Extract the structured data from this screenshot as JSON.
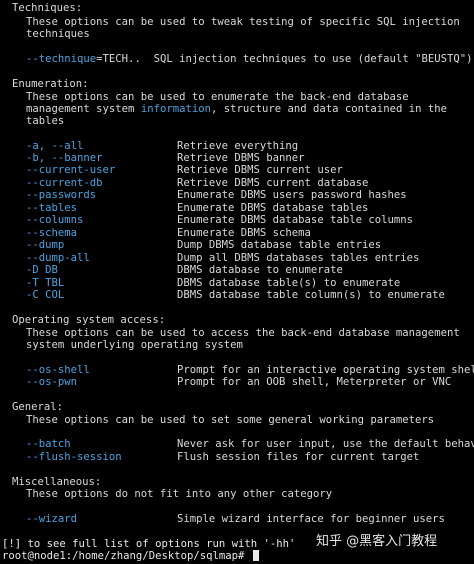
{
  "techniques": {
    "header": "Techniques:",
    "desc1": "These options can be used to tweak testing of specific SQL injection",
    "desc2": "techniques",
    "opt": "--technique",
    "opt_rest": "=TECH..  SQL injection techniques to use (default \"BEUSTQ\")"
  },
  "enumeration": {
    "header": "Enumeration:",
    "desc1": "These options can be used to enumerate the back-end database",
    "desc2_pre": "management system ",
    "desc2_hl": "information",
    "desc2_post": ", structure and data contained in the",
    "desc3": "tables",
    "options": [
      {
        "opt": "-a, --all",
        "desc": "Retrieve everything"
      },
      {
        "opt": "-b, --banner",
        "desc": "Retrieve DBMS banner"
      },
      {
        "opt": "--current-user",
        "desc": "Retrieve DBMS current user"
      },
      {
        "opt": "--current-db",
        "desc": "Retrieve DBMS current database"
      },
      {
        "opt": "--passwords",
        "desc": "Enumerate DBMS users password hashes"
      },
      {
        "opt": "--tables",
        "desc": "Enumerate DBMS database tables"
      },
      {
        "opt": "--columns",
        "desc": "Enumerate DBMS database table columns"
      },
      {
        "opt": "--schema",
        "desc": "Enumerate DBMS schema"
      },
      {
        "opt": "--dump",
        "desc": "Dump DBMS database table entries"
      },
      {
        "opt": "--dump-all",
        "desc": "Dump all DBMS databases tables entries"
      },
      {
        "opt": "-D DB",
        "desc": "DBMS database to enumerate"
      },
      {
        "opt": "-T TBL",
        "desc": "DBMS database table(s) to enumerate"
      },
      {
        "opt": "-C COL",
        "desc": "DBMS database table column(s) to enumerate"
      }
    ]
  },
  "os_access": {
    "header": "Operating system access:",
    "desc1": "These options can be used to access the back-end database management",
    "desc2": "system underlying operating system",
    "options": [
      {
        "opt": "--os-shell",
        "desc": "Prompt for an interactive operating system shell"
      },
      {
        "opt": "--os-pwn",
        "desc": "Prompt for an OOB shell, Meterpreter or VNC"
      }
    ]
  },
  "general": {
    "header": "General:",
    "desc1": "These options can be used to set some general working parameters",
    "options": [
      {
        "opt": "--batch",
        "desc": "Never ask for user input, use the default behavior"
      },
      {
        "opt": "--flush-session",
        "desc": "Flush session files for current target"
      }
    ]
  },
  "misc": {
    "header": "Miscellaneous:",
    "desc1": "These options do not fit into any other category",
    "options": [
      {
        "opt": "--wizard",
        "desc": "Simple wizard interface for beginner users"
      }
    ]
  },
  "footer": {
    "hint": "[!] to see full list of options run with '-hh'",
    "prompt": "root@node1:/home/zhang/Desktop/sqlmap# "
  },
  "watermark": "知乎 @黑客入门教程",
  "colors": {
    "background": "#000000",
    "text": "#d9d9d9",
    "option": "#4aa3df"
  }
}
